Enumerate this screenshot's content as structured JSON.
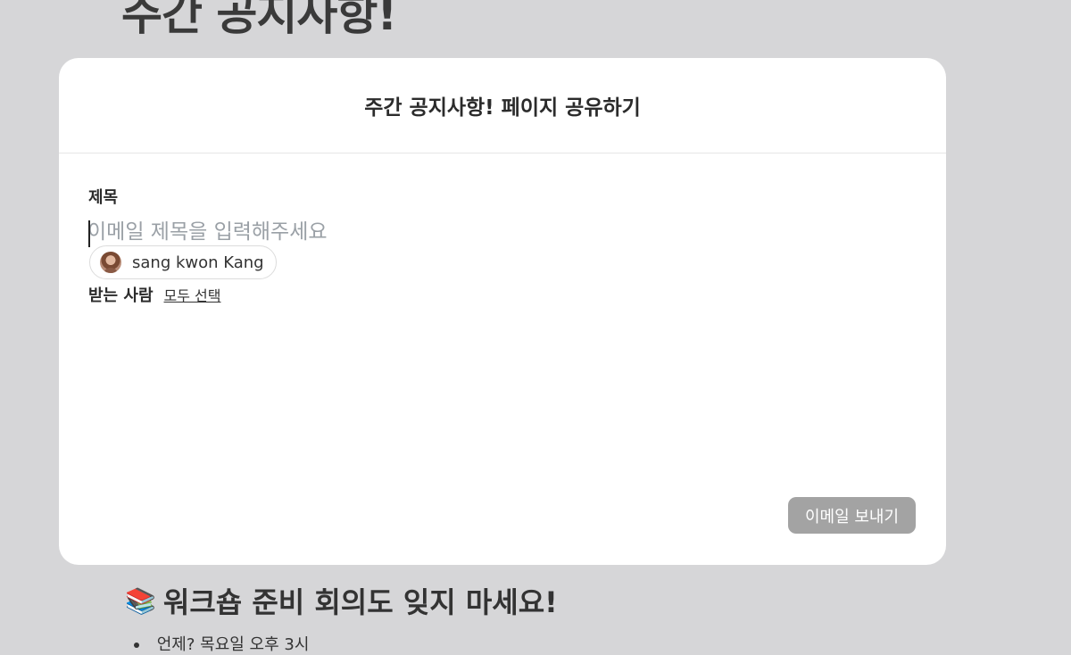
{
  "background": {
    "page_title": "주간 공지사항!",
    "section_heading": "워크숍 준비 회의도 잊지 마세요!",
    "section_icon": "books-icon",
    "list_item": "언제? 목요일 오후 3시"
  },
  "modal": {
    "title": "주간 공지사항! 페이지 공유하기",
    "subject": {
      "label": "제목",
      "value": "",
      "placeholder": "이메일 제목을 입력해주세요"
    },
    "recipients": {
      "label": "받는 사람",
      "select_all": "모두 선택",
      "people": [
        {
          "name": "sang kwon Kang",
          "avatar": "avatar"
        }
      ]
    },
    "send_button": "이메일 보내기"
  },
  "colors": {
    "backdrop": "#d6d6d8",
    "modal_bg": "#ffffff",
    "button_disabled": "#a3a3a3",
    "placeholder": "#9aa0a6"
  }
}
